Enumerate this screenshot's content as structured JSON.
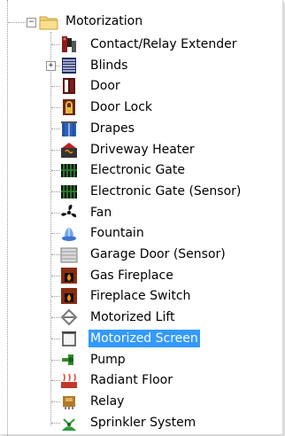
{
  "tree": {
    "parent": {
      "label": "Motorization",
      "expander": "−",
      "icon": "folder-icon"
    },
    "items": [
      {
        "label": "Contact/Relay Extender",
        "icon": "relay-extender-icon"
      },
      {
        "label": "Blinds",
        "icon": "blinds-icon",
        "expander": "+"
      },
      {
        "label": "Door",
        "icon": "door-icon"
      },
      {
        "label": "Door Lock",
        "icon": "door-lock-icon"
      },
      {
        "label": "Drapes",
        "icon": "drapes-icon"
      },
      {
        "label": "Driveway Heater",
        "icon": "driveway-heater-icon"
      },
      {
        "label": "Electronic Gate",
        "icon": "electronic-gate-icon"
      },
      {
        "label": "Electronic Gate (Sensor)",
        "icon": "electronic-gate-sensor-icon"
      },
      {
        "label": "Fan",
        "icon": "fan-icon"
      },
      {
        "label": "Fountain",
        "icon": "fountain-icon"
      },
      {
        "label": "Garage Door (Sensor)",
        "icon": "garage-door-icon"
      },
      {
        "label": "Gas Fireplace",
        "icon": "gas-fireplace-icon"
      },
      {
        "label": "Fireplace Switch",
        "icon": "fireplace-switch-icon"
      },
      {
        "label": "Motorized Lift",
        "icon": "motorized-lift-icon"
      },
      {
        "label": "Motorized Screen",
        "icon": "motorized-screen-icon",
        "selected": true
      },
      {
        "label": "Pump",
        "icon": "pump-icon"
      },
      {
        "label": "Radiant Floor",
        "icon": "radiant-floor-icon"
      },
      {
        "label": "Relay",
        "icon": "relay-icon"
      },
      {
        "label": "Sprinkler System",
        "icon": "sprinkler-icon"
      }
    ]
  },
  "colors": {
    "selection": "#3399ff"
  }
}
